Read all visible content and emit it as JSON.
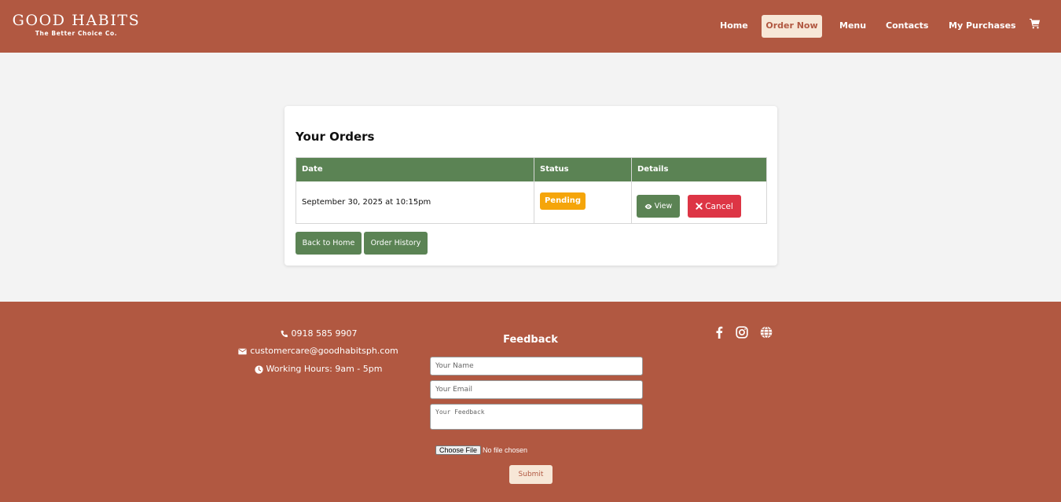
{
  "header": {
    "logo_title": "GOOD HABITS",
    "logo_subtitle": "The Better Choice Co.",
    "nav": {
      "home": "Home",
      "order_now": "Order Now",
      "menu": "Menu",
      "contacts": "Contacts",
      "my_purchases": "My Purchases"
    },
    "cart_icon": "shopping-cart-icon"
  },
  "orders": {
    "title": "Your Orders",
    "columns": [
      "Date",
      "Status",
      "Details"
    ],
    "rows": [
      {
        "date": "September 30, 2025 at 10:15pm",
        "status": "Pending",
        "view_label": "View",
        "cancel_label": "Cancel"
      }
    ],
    "back_home_label": "Back to Home",
    "order_history_label": "Order History"
  },
  "footer": {
    "phone": "0918 585 9907",
    "email": "customercare@goodhabitsph.com",
    "hours": "Working Hours: 9am - 5pm",
    "feedback_title": "Feedback",
    "name_placeholder": "Your Name",
    "email_placeholder": "Your Email",
    "feedback_placeholder": "Your Feedback",
    "file_button": "Choose File",
    "file_status": "No file chosen",
    "submit_label": "Submit",
    "social_icons": [
      "facebook-icon",
      "instagram-icon",
      "globe-icon"
    ]
  },
  "colors": {
    "brand": "#b15841",
    "accent_green": "#5b8354",
    "pending": "#f5a50a",
    "cancel": "#dd3545",
    "cream": "#f7e7d7"
  }
}
